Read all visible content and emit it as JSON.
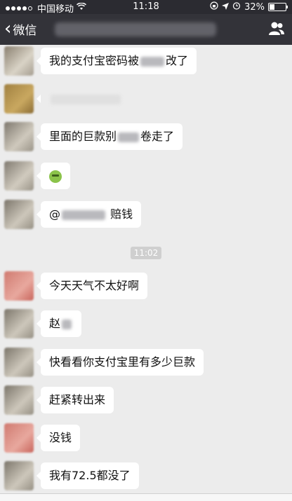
{
  "status_bar": {
    "carrier": "中国移动",
    "time": "11:18",
    "battery": "32%"
  },
  "nav": {
    "back_label": "微信"
  },
  "messages": [
    {
      "pre": "我的支付宝密码被",
      "post": "改了"
    },
    {
      "pre": "",
      "post": ""
    },
    {
      "pre": "里面的巨款别",
      "post": "卷走了"
    },
    {
      "pre": "",
      "post": ""
    },
    {
      "pre": "@",
      "post": " 赔钱"
    },
    {
      "text": "今天天气不太好啊"
    },
    {
      "pre": "赵",
      "post": ""
    },
    {
      "text": "快看看你支付宝里有多少巨款"
    },
    {
      "text": "赶紧转出来"
    },
    {
      "text": "没钱"
    },
    {
      "text": "我有72.5都没了"
    }
  ],
  "timestamp": "11:02",
  "colors": {
    "nav_bg": "#333339",
    "chat_bg": "#ececec",
    "bubble_bg": "#ffffff"
  }
}
